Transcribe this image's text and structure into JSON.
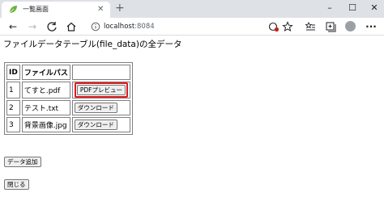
{
  "browser": {
    "tab_title": "一覧画面",
    "address_host": "localhost",
    "address_port": ":8084"
  },
  "page": {
    "heading": "ファイルデータテーブル(file_data)の全データ",
    "table": {
      "headers": [
        "ID",
        "ファイルパス",
        ""
      ],
      "rows": [
        {
          "id": "1",
          "path": "てすと.pdf",
          "action": "PDFプレビュー"
        },
        {
          "id": "2",
          "path": "テスト.txt",
          "action": "ダウンロード"
        },
        {
          "id": "3",
          "path": "背景画像.jpg",
          "action": "ダウンロード"
        }
      ]
    },
    "add_button": "データ追加",
    "close_button": "閉じる"
  },
  "colors": {
    "highlight": "#e0191f",
    "titlebar": "#dee1e6"
  },
  "icons": [
    "leaf-favicon-icon",
    "close-icon",
    "plus-icon",
    "minimize-icon",
    "maximize-icon",
    "back-icon",
    "forward-icon",
    "reload-icon",
    "home-icon",
    "info-icon",
    "tracking-icon",
    "star-icon",
    "favorites-icon",
    "collections-icon",
    "profile-icon",
    "more-icon"
  ]
}
